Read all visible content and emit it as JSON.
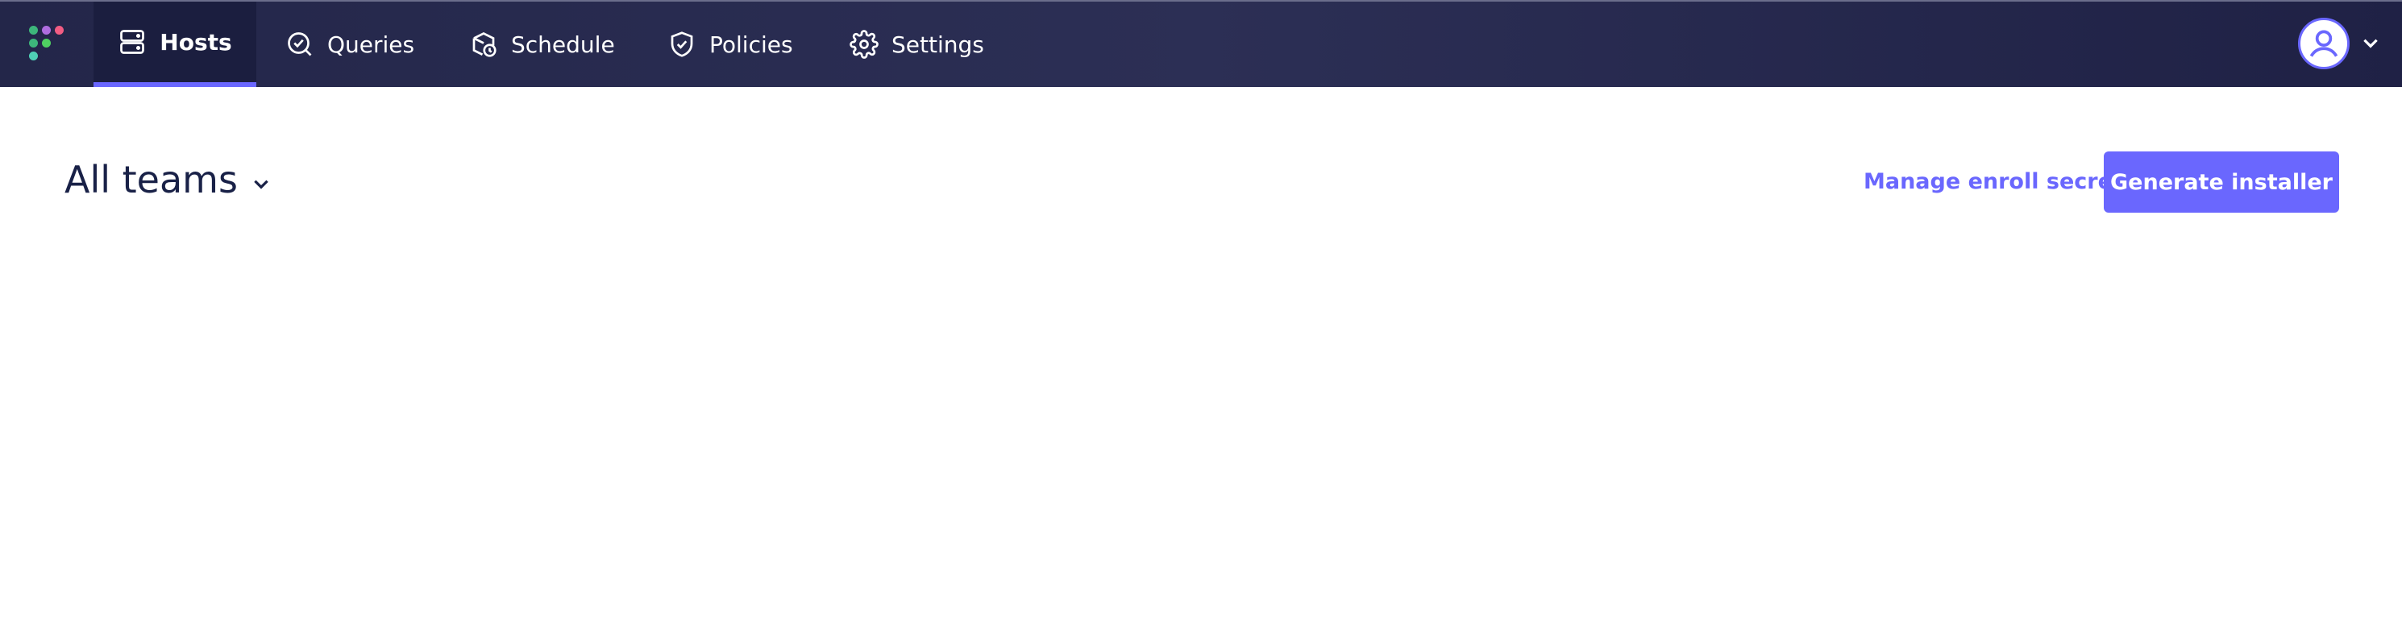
{
  "nav": {
    "items": [
      {
        "label": "Hosts",
        "icon": "hosts-icon",
        "active": true
      },
      {
        "label": "Queries",
        "icon": "queries-icon"
      },
      {
        "label": "Schedule",
        "icon": "schedule-icon"
      },
      {
        "label": "Policies",
        "icon": "policies-icon"
      },
      {
        "label": "Settings",
        "icon": "settings-icon"
      }
    ]
  },
  "header": {
    "team_selector": "All teams"
  },
  "actions": {
    "manage_enroll_secret": "Manage enroll secret",
    "generate_installer": "Generate installer"
  },
  "colors": {
    "accent": "#6a67fe",
    "navbar": "#232649",
    "text_dark": "#192147"
  }
}
